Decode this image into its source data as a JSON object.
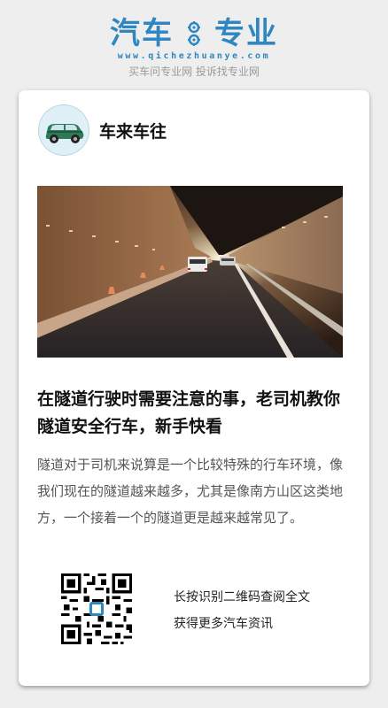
{
  "site": {
    "logo_left": "汽车",
    "logo_right": "专业",
    "domain": "www.qichezhuanye.com",
    "tagline": "买车问专业网 投诉找专业网",
    "brand_color": "#2f86c0"
  },
  "author": {
    "name": "车来车往",
    "avatar_icon": "green-car-icon"
  },
  "article": {
    "hero_icon": "tunnel-road-photo",
    "title": "在隧道行驶时需要注意的事，老司机教你隧道安全行车，新手快看",
    "body": "隧道对于司机来说算是一个比较特殊的行车环境，像我们现在的隧道越来越多，尤其是像南方山区这类地方，一个接着一个的隧道更是越来越常见了。"
  },
  "qr": {
    "icon": "qr-code-icon",
    "line1": "长按识别二维码查阅全文",
    "line2": "获得更多汽车资讯"
  }
}
